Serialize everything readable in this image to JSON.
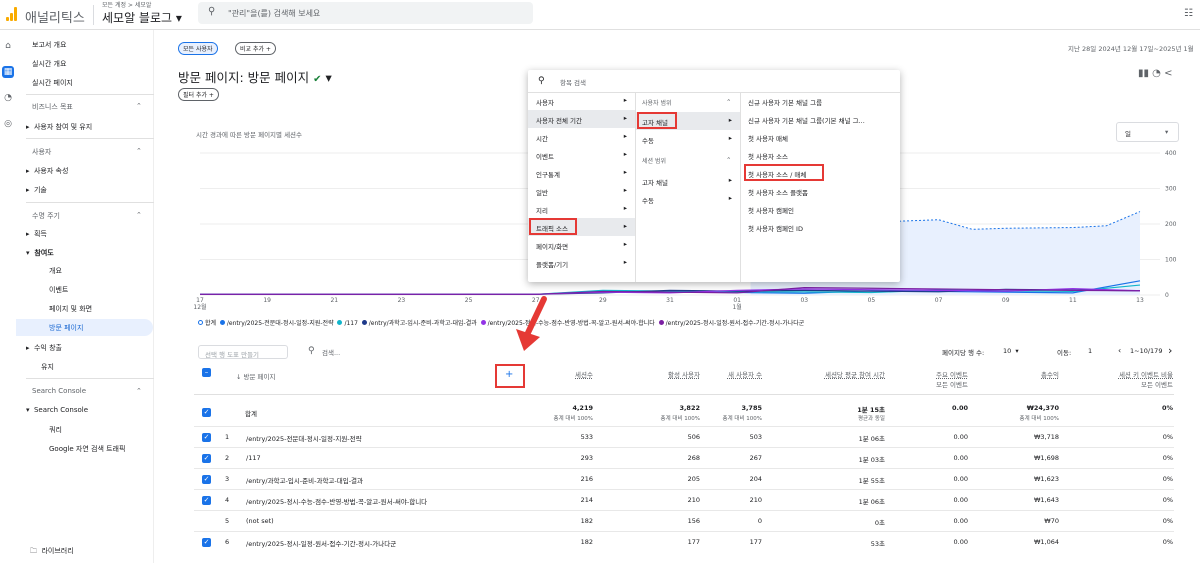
{
  "app": {
    "brand": "애널리틱스",
    "account_small": "모든 계정 > 세모알",
    "account_name": "세모알 블로그"
  },
  "search": {
    "placeholder": "\"관리\"을(를) 검색해 보세요"
  },
  "sidebar": {
    "items": [
      "보고서 개요",
      "실시간 개요",
      "실시간 페이지"
    ],
    "biz": "비즈니스 목표",
    "biz_items": [
      "사용자 참여 및 유지"
    ],
    "user": "사용자",
    "user_items": [
      "사용자 속성",
      "기술"
    ],
    "life": "수명 주기",
    "life_items": [
      "획득",
      "참여도"
    ],
    "engage_sub": [
      "개요",
      "이벤트",
      "페이지 및 화면",
      "방문 페이지"
    ],
    "life_items2": [
      "수익 창출",
      "유지"
    ],
    "sc": "Search Console",
    "sc_items": [
      "Search Console"
    ],
    "sc_sub": [
      "쿼리",
      "Google 자연 검색 트래픽"
    ],
    "library": "라이브러리"
  },
  "main": {
    "chip_all": "모든 사용자",
    "chip_compare": "비교 추가 +",
    "date": "지난 28일  2024년 12월 17일~2025년 1월",
    "title": "방문 페이지: 방문 페이지",
    "filter": "필터 추가 +"
  },
  "chart_data": {
    "type": "line",
    "title": "시간 경과에 따른 방문 페이지별 세션수",
    "period": "일",
    "x": [
      "17",
      "19",
      "21",
      "23",
      "25",
      "27",
      "29",
      "31",
      "01",
      "03",
      "05",
      "07",
      "09",
      "11",
      "13"
    ],
    "x_month_labels": [
      "12월",
      "1월"
    ],
    "y_ticks": [
      "400",
      "300",
      "200",
      "100",
      "0"
    ],
    "ylim": [
      0,
      400
    ],
    "series": [
      {
        "name": "/entry/2025-전문대-정시-일정-지원-전략",
        "color": "#1a73e8"
      },
      {
        "name": "/117",
        "color": "#12b5cb"
      },
      {
        "name": "/entry/과학고-입시-준비-과학고-대입-결과",
        "color": "#1e3a8a"
      },
      {
        "name": "/entry/2025-정시-수능-점수-반영-방법-꼭-알고-원서-써야-합니다",
        "color": "#9334e6"
      },
      {
        "name": "/entry/2025-정시-일정-원서-접수-기간-정시-가나다군",
        "color": "#7b1fa2"
      }
    ],
    "legend_total": "합계"
  },
  "dropdown": {
    "search": "항목 검색",
    "col1": [
      "사용자",
      "사용자 전체 기간",
      "시간",
      "이벤트",
      "인구통계",
      "일반",
      "지리",
      "트래픽 소스",
      "페이지/화면",
      "플랫폼/기기"
    ],
    "col2_head1": "사용자 범위",
    "col2a": [
      "고자 채널",
      "수동"
    ],
    "col2_head2": "세션 범위",
    "col2b": [
      "고자 채널",
      "수동"
    ],
    "col3": [
      "신규 사용자 기본 채널 그룹",
      "신규 사용자 기본 채널 그룹(기본 채널 그...",
      "첫 사용자 매체",
      "첫 사용자 소스",
      "첫 사용자 소스 / 매체",
      "첫 사용자 소스 플랫폼",
      "첫 사용자 캠페인",
      "첫 사용자 캠페인 ID"
    ]
  },
  "table": {
    "search_placeholder": "검색...",
    "segment_btn": "선택 행 도표 만들기",
    "rows_per_page_label": "페이지당 행 수:",
    "rows_per_page": "10",
    "goto_label": "이동:",
    "goto": "1",
    "range": "1~10/179",
    "dim_header": "방문 페이지",
    "headers": [
      "세션수",
      "활성 사용자",
      "새 사용자 수",
      "세션당 평균 참여 시간",
      "주요 이벤트",
      "총수익",
      "세션 키 이벤트 비율"
    ],
    "sub_headers": [
      "모든 이벤트",
      "모든 이벤트"
    ],
    "total_label": "합계",
    "totals": [
      "4,219",
      "3,822",
      "3,785",
      "1분 15초",
      "0.00",
      "₩24,370",
      "0%"
    ],
    "totals_sub": [
      "총계 대비 100%",
      "총계 대비 100%",
      "총계 대비 100%",
      "평균과 동일",
      "",
      "총계 대비 100%",
      ""
    ],
    "rows": [
      {
        "n": "1",
        "page": "/entry/2025-전문대-정시-일정-지원-전략",
        "v": [
          "533",
          "506",
          "503",
          "1분 06초",
          "0.00",
          "₩3,718",
          "0%"
        ]
      },
      {
        "n": "2",
        "page": "/117",
        "v": [
          "293",
          "268",
          "267",
          "1분 03초",
          "0.00",
          "₩1,698",
          "0%"
        ]
      },
      {
        "n": "3",
        "page": "/entry/과학고-입시-준비-과학고-대입-결과",
        "v": [
          "216",
          "205",
          "204",
          "1분 55초",
          "0.00",
          "₩1,623",
          "0%"
        ]
      },
      {
        "n": "4",
        "page": "/entry/2025-정시-수능-점수-반영-방법-꼭-알고-원서-써야-합니다",
        "v": [
          "214",
          "210",
          "210",
          "1분 06초",
          "0.00",
          "₩1,643",
          "0%"
        ]
      },
      {
        "n": "5",
        "page": "(not set)",
        "v": [
          "182",
          "156",
          "0",
          "0초",
          "0.00",
          "₩70",
          "0%"
        ]
      },
      {
        "n": "6",
        "page": "/entry/2025-정시-일정-원서-접수-기간-정시-가나다군",
        "v": [
          "182",
          "177",
          "177",
          "53초",
          "0.00",
          "₩1,064",
          "0%"
        ]
      }
    ]
  }
}
